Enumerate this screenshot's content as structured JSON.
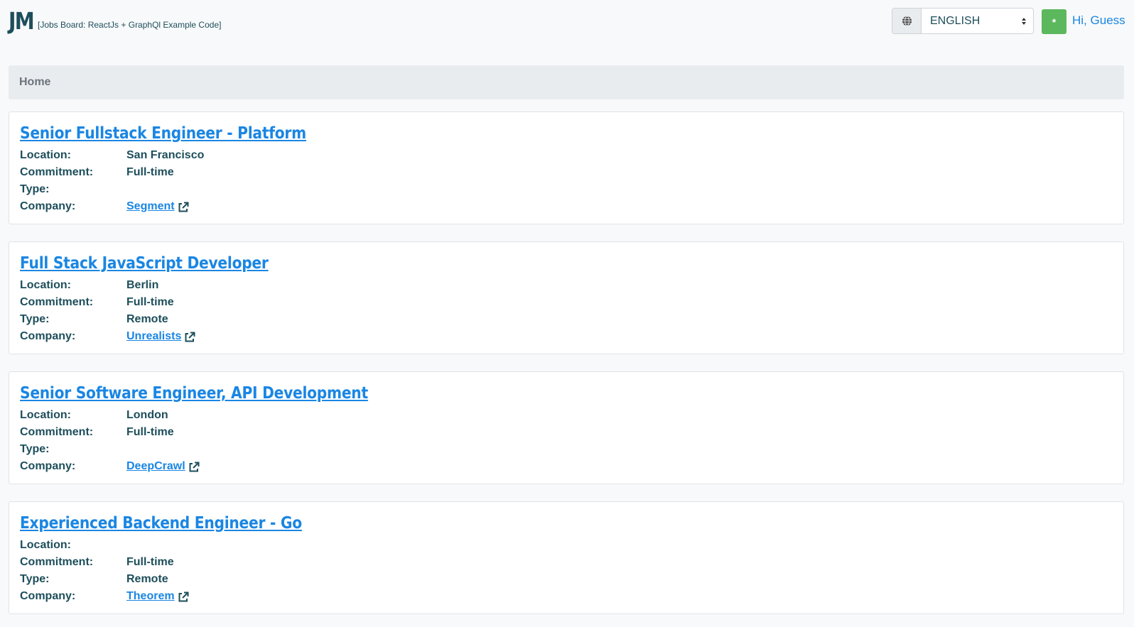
{
  "header": {
    "logo": "JM",
    "tagline": "[Jobs Board: ReactJs + GraphQl Example Code]",
    "language": {
      "icon": "globe-icon",
      "selected": "ENGLISH"
    },
    "user_button": {
      "icon": "asterisk-icon",
      "glyph": "*",
      "color": "#5cb85c"
    },
    "greeting_prefix": "Hi,",
    "user_name": "Guess"
  },
  "breadcrumb": {
    "items": [
      "Home"
    ]
  },
  "labels": {
    "location": "Location:",
    "commitment": "Commitment:",
    "type": "Type:",
    "company": "Company:"
  },
  "jobs": [
    {
      "title": "Senior Fullstack Engineer - Platform",
      "location": "San Francisco",
      "commitment": "Full-time",
      "type": "",
      "company": "Segment"
    },
    {
      "title": "Full Stack JavaScript Developer",
      "location": "Berlin",
      "commitment": "Full-time",
      "type": "Remote",
      "company": "Unrealists"
    },
    {
      "title": "Senior Software Engineer, API Development",
      "location": "London",
      "commitment": "Full-time",
      "type": "",
      "company": "DeepCrawl"
    },
    {
      "title": "Experienced Backend Engineer - Go",
      "location": "",
      "commitment": "Full-time",
      "type": "Remote",
      "company": "Theorem"
    }
  ],
  "colors": {
    "link": "#1a86e3",
    "text": "#1d4e5b",
    "breadcrumb_bg": "#e9ecef"
  }
}
